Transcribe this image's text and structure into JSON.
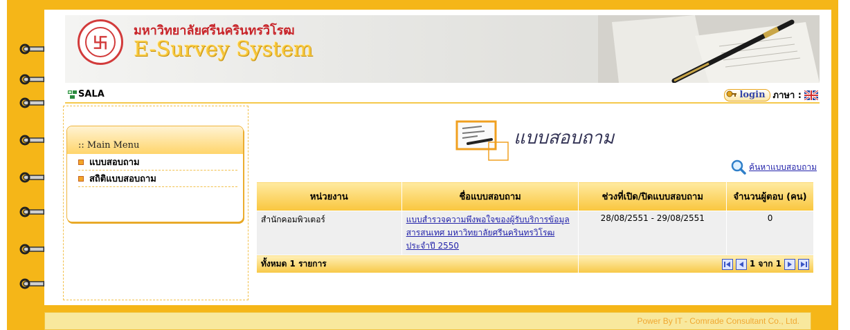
{
  "header": {
    "university_name": "มหาวิทยาลัยศรีนครินทรวิโรฒ",
    "system_title": "E-Survey System",
    "logo_glyph": "卐"
  },
  "topbar": {
    "site_label": "SALA",
    "login_label": "login",
    "language_label": "ภาษา :"
  },
  "sidebar": {
    "menu_title": ":: Main Menu",
    "items": [
      {
        "label": "แบบสอบถาม"
      },
      {
        "label": "สถิติแบบสอบถาม"
      }
    ]
  },
  "main": {
    "page_title": "แบบสอบถาม",
    "search_link": "ค้นหาแบบสอบถาม",
    "table": {
      "columns": [
        "หน่วยงาน",
        "ชื่อแบบสอบถาม",
        "ช่วงที่เปิด/ปิดแบบสอบถาม",
        "จำนวนผู้ตอบ (คน)"
      ],
      "rows": [
        {
          "department": "สำนักคอมพิวเตอร์",
          "survey_name": "แบบสำรวจความพึงพอใจของผู้รับบริการข้อมูลสารสนเทศ มหาวิทยาลัยศรีนครินทรวิโรฒ ประจำปี 2550",
          "period": "28/08/2551 - 29/08/2551",
          "respondents": "0"
        }
      ],
      "total_label": "ทั้งหมด  1  รายการ",
      "pager": "1 จาก 1"
    }
  },
  "footer": {
    "powered_by": "Power By IT - Comrade Consultant Co., Ltd."
  },
  "colors": {
    "frame": "#f5b618",
    "accent_red": "#c8252a",
    "link": "#2222aa"
  }
}
